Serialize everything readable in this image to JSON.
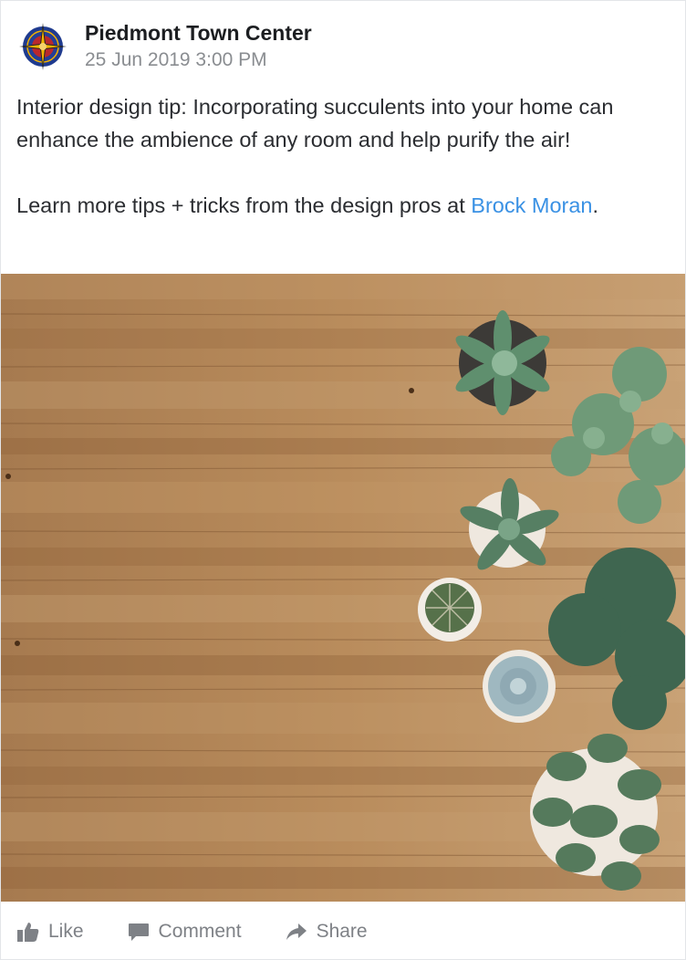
{
  "post": {
    "page_name": "Piedmont Town Center",
    "timestamp": "25 Jun 2019 3:00 PM",
    "text_paragraph_1": "Interior design tip: Incorporating succulents into your home can enhance the ambience of any room and help purify the air!",
    "text_paragraph_2_prefix": "Learn more tips + tricks from the design pros at ",
    "text_paragraph_2_link": "Brock Moran",
    "text_paragraph_2_suffix": ".",
    "link_color": "#3a91e4",
    "image_icon": "photo-succulents-on-wood-table"
  },
  "actions": {
    "like_label": "Like",
    "like_icon": "thumbs-up-icon",
    "comment_label": "Comment",
    "comment_icon": "comment-bubble-icon",
    "share_label": "Share",
    "share_icon": "share-arrow-icon"
  },
  "avatar_icon": "compass-rose-logo"
}
